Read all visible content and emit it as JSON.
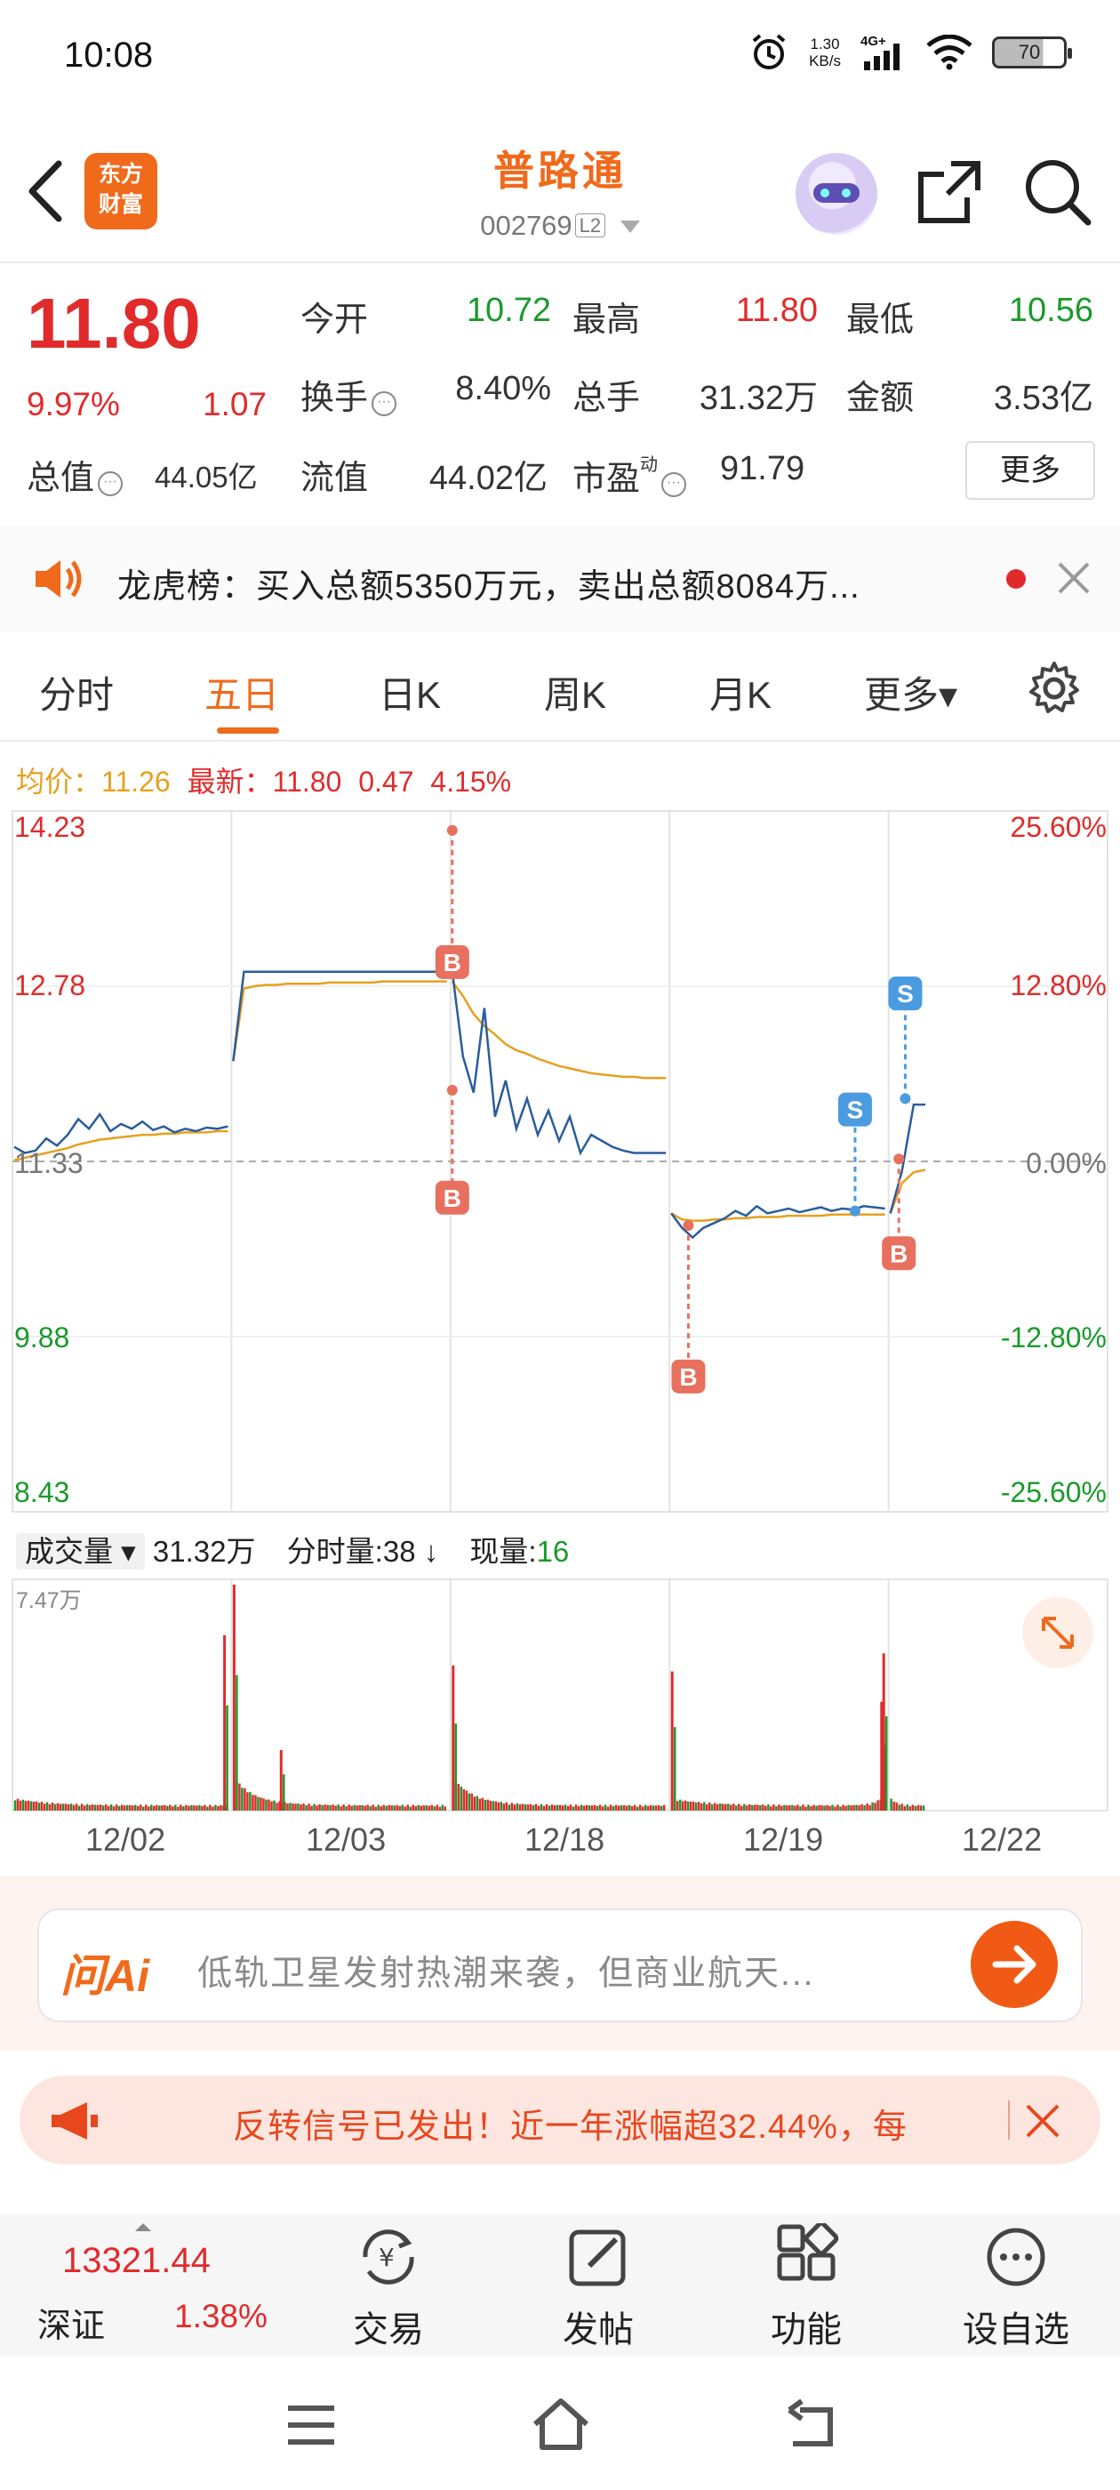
{
  "status_bar": {
    "time": "10:08",
    "net_speed_value": "1.30",
    "net_speed_unit": "KB/s",
    "network": "4G+",
    "battery": "70",
    "icons": [
      "alarm-icon",
      "signal-icon",
      "wifi-icon",
      "battery-icon"
    ]
  },
  "header": {
    "logo_line1": "东方",
    "logo_line2": "财富",
    "stock_name": "普路通",
    "stock_code": "002769",
    "level": "L2"
  },
  "quote": {
    "price": "11.80",
    "change_pct": "9.97%",
    "change": "1.07",
    "open_label": "今开",
    "open": "10.72",
    "high_label": "最高",
    "high": "11.80",
    "low_label": "最低",
    "low": "10.56",
    "turnover_label": "换手",
    "turnover": "8.40%",
    "volume_label": "总手",
    "volume": "31.32万",
    "amount_label": "金额",
    "amount": "3.53亿",
    "mktcap_label": "总值",
    "mktcap": "44.05亿",
    "float_label": "流值",
    "float_cap": "44.02亿",
    "pe_label": "市盈",
    "pe_sup": "动",
    "pe": "91.79",
    "more_button": "更多"
  },
  "ticker": {
    "text": "龙虎榜：买入总额5350万元，卖出总额8084万..."
  },
  "tabs": [
    {
      "label": "分时"
    },
    {
      "label": "五日"
    },
    {
      "label": "日K"
    },
    {
      "label": "周K"
    },
    {
      "label": "月K"
    },
    {
      "label": "更多▾"
    }
  ],
  "chart_header": {
    "avg_label": "均价：",
    "avg_value": "11.26",
    "latest_label": "最新：",
    "latest_value": "11.80",
    "change": "0.47",
    "pct": "4.15%"
  },
  "chart_data": {
    "type": "line",
    "x_categories": [
      "12/02",
      "12/03",
      "12/18",
      "12/19",
      "12/22"
    ],
    "y_left_ticks": [
      "14.23",
      "12.78",
      "11.33",
      "9.88",
      "8.43"
    ],
    "y_right_ticks": [
      "25.60%",
      "12.80%",
      "0.00%",
      "-12.80%",
      "-25.60%"
    ],
    "ylim": [
      8.43,
      14.23
    ],
    "reference_price": 11.33,
    "colors": {
      "price": "#2a5d9c",
      "avg": "#e6a01f",
      "buy": "#e8705f",
      "sell": "#4a9be0"
    },
    "segments": [
      {
        "day": "12/02",
        "price": [
          11.45,
          11.4,
          11.42,
          11.52,
          11.46,
          11.55,
          11.68,
          11.6,
          11.72,
          11.58,
          11.64,
          11.6,
          11.66,
          11.59,
          11.62,
          11.57,
          11.6,
          11.58,
          11.61,
          11.6,
          11.62
        ],
        "avg": [
          11.34,
          11.36,
          11.38,
          11.4,
          11.42,
          11.44,
          11.47,
          11.49,
          11.51,
          11.52,
          11.53,
          11.54,
          11.55,
          11.55,
          11.56,
          11.56,
          11.57,
          11.57,
          11.57,
          11.58,
          11.58
        ]
      },
      {
        "day": "12/03",
        "price": [
          12.16,
          12.9,
          12.9,
          12.9,
          12.9,
          12.9,
          12.9,
          12.9,
          12.9,
          12.9,
          12.9,
          12.9,
          12.9,
          12.9,
          12.9,
          12.9,
          12.9,
          12.9,
          12.9,
          12.9,
          12.9
        ],
        "avg": [
          12.16,
          12.76,
          12.78,
          12.79,
          12.79,
          12.8,
          12.8,
          12.8,
          12.8,
          12.81,
          12.81,
          12.81,
          12.81,
          12.81,
          12.82,
          12.82,
          12.82,
          12.82,
          12.82,
          12.82,
          12.82
        ]
      },
      {
        "day": "12/18",
        "price": [
          12.9,
          12.2,
          11.9,
          12.6,
          11.7,
          12.0,
          11.6,
          11.85,
          11.55,
          11.75,
          11.5,
          11.7,
          11.4,
          11.55,
          11.5,
          11.45,
          11.42,
          11.4,
          11.4,
          11.4,
          11.4
        ],
        "avg": [
          12.82,
          12.7,
          12.55,
          12.45,
          12.38,
          12.3,
          12.25,
          12.22,
          12.18,
          12.15,
          12.12,
          12.1,
          12.08,
          12.06,
          12.05,
          12.04,
          12.03,
          12.03,
          12.02,
          12.02,
          12.02
        ]
      },
      {
        "day": "12/19",
        "price": [
          10.9,
          10.78,
          10.7,
          10.78,
          10.82,
          10.86,
          10.92,
          10.88,
          10.96,
          10.9,
          10.92,
          10.94,
          10.91,
          10.93,
          10.95,
          10.92,
          10.94,
          10.93,
          10.96,
          10.95,
          10.94
        ],
        "avg": [
          10.9,
          10.85,
          10.84,
          10.84,
          10.85,
          10.85,
          10.86,
          10.86,
          10.87,
          10.87,
          10.87,
          10.88,
          10.88,
          10.88,
          10.88,
          10.89,
          10.89,
          10.89,
          10.89,
          10.89,
          10.89
        ]
      },
      {
        "day": "12/22",
        "price": [
          10.9,
          11.25,
          11.8,
          11.8
        ],
        "avg": [
          10.9,
          11.15,
          11.24,
          11.26
        ]
      }
    ],
    "markers": [
      {
        "label": "B",
        "day_index": 2,
        "pos": 0.0,
        "price": 14.07,
        "tag_y": 12.98,
        "side": "buy"
      },
      {
        "label": "B",
        "day_index": 2,
        "pos": 0.0,
        "price": 11.92,
        "tag_y": 11.03,
        "side": "buy"
      },
      {
        "label": "B",
        "day_index": 3,
        "pos": 0.08,
        "price": 10.8,
        "tag_y": 9.55,
        "side": "buy"
      },
      {
        "label": "S",
        "day_index": 3,
        "pos": 0.86,
        "price": 10.92,
        "tag_y": 11.76,
        "side": "sell"
      },
      {
        "label": "B",
        "day_index": 4,
        "pos": 0.04,
        "price": 11.35,
        "tag_y": 10.57,
        "side": "buy"
      },
      {
        "label": "S",
        "day_index": 4,
        "pos": 0.07,
        "price": 11.85,
        "tag_y": 12.72,
        "side": "sell"
      }
    ],
    "volume": {
      "max_label": "7.47万",
      "max_value": 74700,
      "spikes": [
        {
          "day_index": 0,
          "pos": 0.98,
          "value": 58000
        },
        {
          "day_index": 1,
          "pos": 0.0,
          "value": 74700
        },
        {
          "day_index": 1,
          "pos": 0.22,
          "value": 20000
        },
        {
          "day_index": 2,
          "pos": 0.0,
          "value": 48000
        },
        {
          "day_index": 3,
          "pos": 0.0,
          "value": 46000
        },
        {
          "day_index": 3,
          "pos": 0.98,
          "value": 36000
        },
        {
          "day_index": 3,
          "pos": 0.99,
          "value": 52000
        }
      ]
    }
  },
  "volume_header": {
    "label": "成交量",
    "total": "31.32万",
    "minute_label": "分时量:",
    "minute_value": "38",
    "minute_arrow": "↓",
    "now_label": "现量:",
    "now_value": "16"
  },
  "ai": {
    "logo": "问Ai",
    "placeholder": "低轨卫星发射热潮来袭，但商业航天..."
  },
  "promo": {
    "text": "反转信号已发出！近一年涨幅超32.44%，每"
  },
  "bottom_nav": {
    "index_value": "13321.44",
    "index_name": "深证",
    "index_pct": "1.38%",
    "items": [
      {
        "label": "交易",
        "icon": "yuan-exchange-icon"
      },
      {
        "label": "发帖",
        "icon": "edit-icon"
      },
      {
        "label": "功能",
        "icon": "grid-icon"
      },
      {
        "label": "设自选",
        "icon": "more-dots-icon"
      }
    ]
  }
}
